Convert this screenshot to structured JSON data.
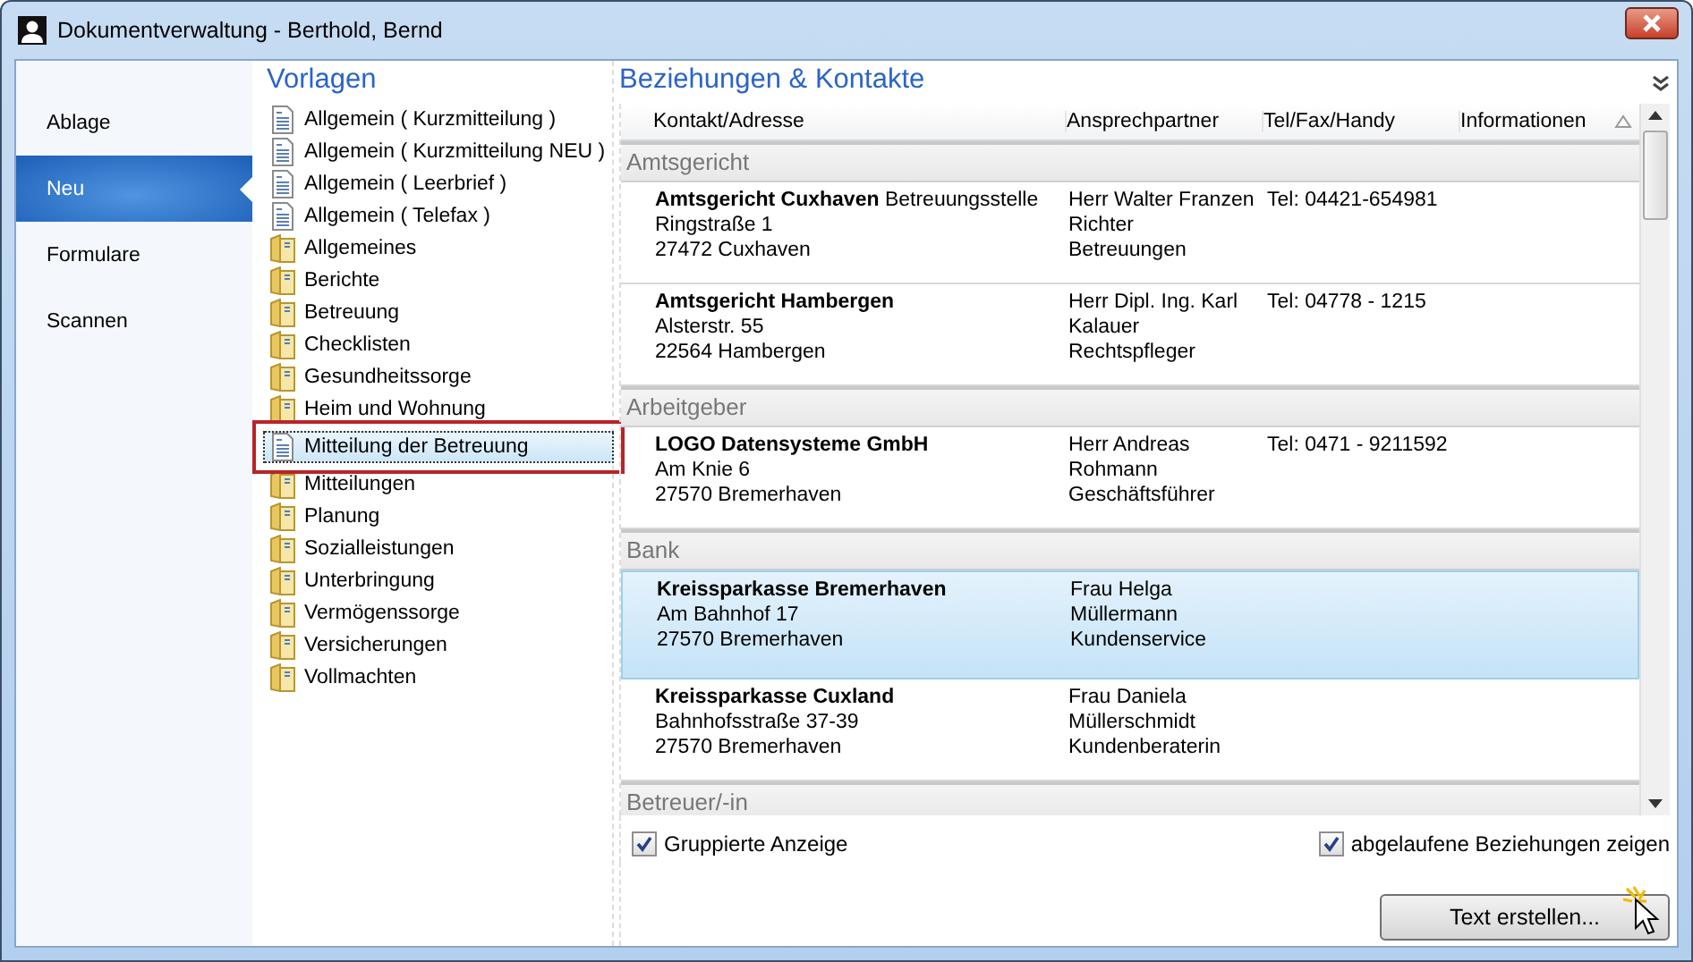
{
  "window": {
    "title": "Dokumentverwaltung - Berthold, Bernd"
  },
  "nav": [
    {
      "label": "Ablage",
      "selected": false
    },
    {
      "label": "Neu",
      "selected": true
    },
    {
      "label": "Formulare",
      "selected": false
    },
    {
      "label": "Scannen",
      "selected": false
    }
  ],
  "templates": {
    "title": "Vorlagen",
    "items": [
      {
        "label": "Allgemein ( Kurzmitteilung )",
        "kind": "document",
        "selected": false
      },
      {
        "label": "Allgemein ( Kurzmitteilung NEU )",
        "kind": "document",
        "selected": false
      },
      {
        "label": "Allgemein ( Leerbrief )",
        "kind": "document",
        "selected": false
      },
      {
        "label": "Allgemein ( Telefax )",
        "kind": "document",
        "selected": false
      },
      {
        "label": "Allgemeines",
        "kind": "folder",
        "selected": false
      },
      {
        "label": "Berichte",
        "kind": "folder",
        "selected": false
      },
      {
        "label": "Betreuung",
        "kind": "folder",
        "selected": false
      },
      {
        "label": "Checklisten",
        "kind": "folder",
        "selected": false
      },
      {
        "label": "Gesundheitssorge",
        "kind": "folder",
        "selected": false
      },
      {
        "label": "Heim und Wohnung",
        "kind": "folder",
        "selected": false
      },
      {
        "label": "Mitteilung der Betreuung",
        "kind": "document",
        "selected": true
      },
      {
        "label": "Mitteilungen",
        "kind": "folder",
        "selected": false
      },
      {
        "label": "Planung",
        "kind": "folder",
        "selected": false
      },
      {
        "label": "Sozialleistungen",
        "kind": "folder",
        "selected": false
      },
      {
        "label": "Unterbringung",
        "kind": "folder",
        "selected": false
      },
      {
        "label": "Vermögenssorge",
        "kind": "folder",
        "selected": false
      },
      {
        "label": "Versicherungen",
        "kind": "folder",
        "selected": false
      },
      {
        "label": "Vollmachten",
        "kind": "folder",
        "selected": false
      }
    ]
  },
  "contacts": {
    "title": "Beziehungen & Kontakte",
    "columns": [
      "Kontakt/Adresse",
      "Ansprechpartner",
      "Tel/Fax/Handy",
      "Informationen"
    ],
    "groups": [
      {
        "name": "Amtsgericht",
        "rows": [
          {
            "name": "Amtsgericht Cuxhaven",
            "name_suffix": "Betreuungsstelle",
            "address": [
              "Ringstraße 1",
              "27472 Cuxhaven"
            ],
            "partner": [
              "Herr Walter Franzen",
              "Richter",
              "Betreuungen"
            ],
            "phone": "Tel: 04421-654981",
            "selected": false
          },
          {
            "name": "Amtsgericht Hambergen",
            "address": [
              "Alsterstr. 55",
              "22564 Hambergen"
            ],
            "partner": [
              "Herr Dipl. Ing. Karl",
              "Kalauer",
              "Rechtspfleger"
            ],
            "phone": "Tel: 04778 - 1215",
            "selected": false
          }
        ]
      },
      {
        "name": "Arbeitgeber",
        "rows": [
          {
            "name": "LOGO Datensysteme GmbH",
            "address": [
              "Am Knie 6",
              "27570 Bremerhaven"
            ],
            "partner": [
              "Herr Andreas",
              "Rohmann",
              "Geschäftsführer"
            ],
            "phone": "Tel: 0471 - 9211592",
            "selected": false
          }
        ]
      },
      {
        "name": "Bank",
        "rows": [
          {
            "name": "Kreissparkasse Bremerhaven",
            "address": [
              "Am Bahnhof 17",
              "27570 Bremerhaven"
            ],
            "partner": [
              "Frau Helga",
              "Müllermann",
              "Kundenservice"
            ],
            "selected": true
          },
          {
            "name": "Kreissparkasse Cuxland",
            "address": [
              "Bahnhofsstraße 37-39",
              "27570 Bremerhaven"
            ],
            "partner": [
              "Frau Daniela",
              "Müllerschmidt",
              "Kundenberaterin"
            ],
            "selected": false
          }
        ]
      },
      {
        "name": "Betreuer/-in"
      }
    ]
  },
  "options": [
    {
      "label": "Gruppierte Anzeige",
      "checked": true
    },
    {
      "label": "abgelaufene Beziehungen zeigen",
      "checked": true
    }
  ],
  "button": "Text erstellen..."
}
